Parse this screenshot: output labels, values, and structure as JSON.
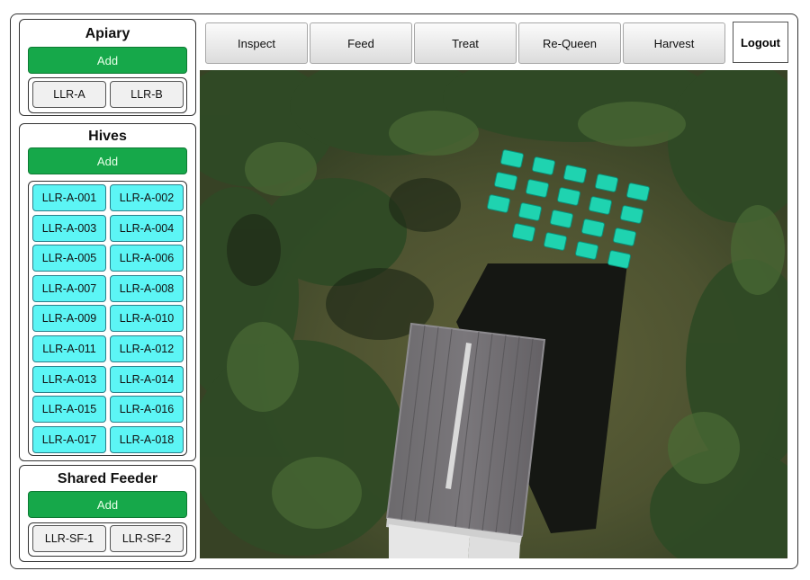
{
  "apiary": {
    "title": "Apiary",
    "add_label": "Add",
    "items": [
      "LLR-A",
      "LLR-B"
    ]
  },
  "hives": {
    "title": "Hives",
    "add_label": "Add",
    "items": [
      "LLR-A-001",
      "LLR-A-002",
      "LLR-A-003",
      "LLR-A-004",
      "LLR-A-005",
      "LLR-A-006",
      "LLR-A-007",
      "LLR-A-008",
      "LLR-A-009",
      "LLR-A-010",
      "LLR-A-011",
      "LLR-A-012",
      "LLR-A-013",
      "LLR-A-014",
      "LLR-A-015",
      "LLR-A-016",
      "LLR-A-017",
      "LLR-A-018"
    ]
  },
  "shared_feeder": {
    "title": "Shared Feeder",
    "add_label": "Add",
    "items": [
      "LLR-SF-1",
      "LLR-SF-2"
    ]
  },
  "toolbar": {
    "inspect": "Inspect",
    "feed": "Feed",
    "treat": "Treat",
    "requeen": "Re-Queen",
    "harvest": "Harvest"
  },
  "logout_label": "Logout",
  "colors": {
    "add_button": "#16a84a",
    "hive_chip": "#5cf5f5",
    "hive_marker": "#1fd3b0"
  }
}
